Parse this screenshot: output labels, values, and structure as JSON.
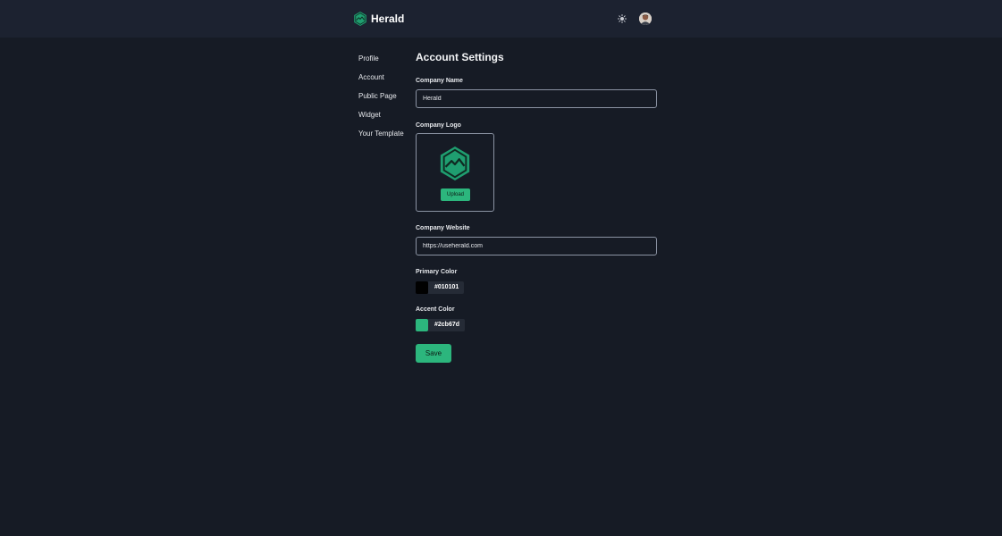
{
  "app": {
    "name": "Herald"
  },
  "header": {
    "theme_icon": "sun-icon",
    "avatar_icon": "user-avatar"
  },
  "sidebar": {
    "items": [
      {
        "label": "Profile"
      },
      {
        "label": "Account"
      },
      {
        "label": "Public Page"
      },
      {
        "label": "Widget"
      },
      {
        "label": "Your Template"
      }
    ]
  },
  "main": {
    "title": "Account Settings",
    "company_name": {
      "label": "Company Name",
      "value": "Herald"
    },
    "company_logo": {
      "label": "Company Logo",
      "upload_label": "Upload"
    },
    "company_website": {
      "label": "Company Website",
      "value": "https://useherald.com"
    },
    "primary_color": {
      "label": "Primary Color",
      "value": "#010101"
    },
    "accent_color": {
      "label": "Accent Color",
      "value": "#2cb67d"
    },
    "save_label": "Save"
  },
  "colors": {
    "brand": "#2cb67d",
    "background": "#161b25",
    "header": "#1c2230"
  }
}
